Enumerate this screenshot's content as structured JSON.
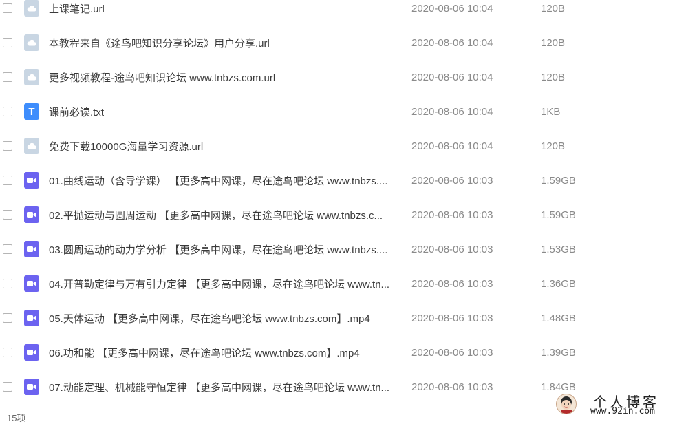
{
  "files": [
    {
      "type": "url",
      "name": "上课笔记.url",
      "date": "2020-08-06 10:04",
      "size": "120B"
    },
    {
      "type": "url",
      "name": "本教程来自《途鸟吧知识分享论坛》用户分享.url",
      "date": "2020-08-06 10:04",
      "size": "120B"
    },
    {
      "type": "url",
      "name": "更多视频教程-途鸟吧知识论坛 www.tnbzs.com.url",
      "date": "2020-08-06 10:04",
      "size": "120B"
    },
    {
      "type": "txt",
      "name": "课前必读.txt",
      "date": "2020-08-06 10:04",
      "size": "1KB"
    },
    {
      "type": "url",
      "name": "免费下载10000G海量学习资源.url",
      "date": "2020-08-06 10:04",
      "size": "120B"
    },
    {
      "type": "mp4",
      "name": "01.曲线运动（含导学课） 【更多高中网课，尽在途鸟吧论坛 www.tnbzs....",
      "date": "2020-08-06 10:03",
      "size": "1.59GB"
    },
    {
      "type": "mp4",
      "name": "02.平抛运动与圆周运动 【更多高中网课，尽在途鸟吧论坛 www.tnbzs.c...",
      "date": "2020-08-06 10:03",
      "size": "1.59GB"
    },
    {
      "type": "mp4",
      "name": "03.圆周运动的动力学分析 【更多高中网课，尽在途鸟吧论坛 www.tnbzs....",
      "date": "2020-08-06 10:03",
      "size": "1.53GB"
    },
    {
      "type": "mp4",
      "name": "04.开普勒定律与万有引力定律 【更多高中网课，尽在途鸟吧论坛 www.tn...",
      "date": "2020-08-06 10:03",
      "size": "1.36GB"
    },
    {
      "type": "mp4",
      "name": "05.天体运动 【更多高中网课，尽在途鸟吧论坛 www.tnbzs.com】.mp4",
      "date": "2020-08-06 10:03",
      "size": "1.48GB"
    },
    {
      "type": "mp4",
      "name": "06.功和能 【更多高中网课，尽在途鸟吧论坛 www.tnbzs.com】.mp4",
      "date": "2020-08-06 10:03",
      "size": "1.39GB"
    },
    {
      "type": "mp4",
      "name": "07.动能定理、机械能守恒定律 【更多高中网课，尽在途鸟吧论坛 www.tn...",
      "date": "2020-08-06 10:03",
      "size": "1.84GB"
    }
  ],
  "icons": {
    "url": "cloud-file-icon",
    "txt": "text-file-icon",
    "mp4": "video-file-icon"
  },
  "icon_glyphs": {
    "txt": "T"
  },
  "colors": {
    "video_icon": "#6c63f0",
    "text_icon": "#3e8dfc",
    "url_icon": "#c9d6e3"
  },
  "footer": {
    "count": "15项"
  },
  "watermark": {
    "title": "个人博客",
    "url": "www.92in.com"
  }
}
